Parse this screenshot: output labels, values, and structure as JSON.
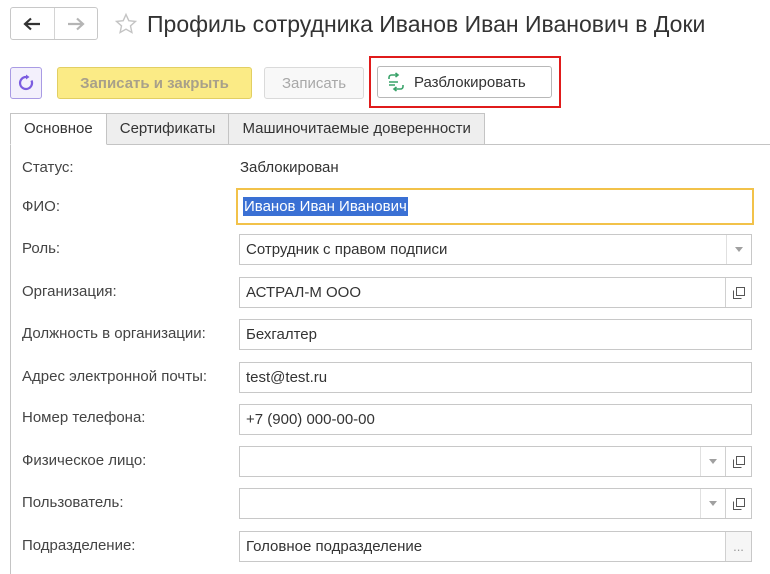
{
  "window": {
    "title": "Профиль сотрудника Иванов Иван Иванович в Доки"
  },
  "toolbar": {
    "save_close_label": "Записать и закрыть",
    "save_label": "Записать",
    "unlock_label": "Разблокировать"
  },
  "tabs": [
    {
      "label": "Основное",
      "active": true
    },
    {
      "label": "Сертификаты",
      "active": false
    },
    {
      "label": "Машиночитаемые доверенности",
      "active": false
    }
  ],
  "form": {
    "status": {
      "label": "Статус:",
      "value": "Заблокирован"
    },
    "fio": {
      "label": "ФИО:",
      "value": "Иванов Иван Иванович"
    },
    "role": {
      "label": "Роль:",
      "value": "Сотрудник с правом подписи"
    },
    "organization": {
      "label": "Организация:",
      "value": "АСТРАЛ-М ООО"
    },
    "position": {
      "label": "Должность в организации:",
      "value": "Бехгалтер"
    },
    "email": {
      "label": "Адрес электронной почты:",
      "value": "test@test.ru"
    },
    "phone": {
      "label": "Номер телефона:",
      "value": "+7 (900) 000-00-00"
    },
    "person": {
      "label": "Физическое лицо:",
      "value": ""
    },
    "user": {
      "label": "Пользователь:",
      "value": ""
    },
    "department": {
      "label": "Подразделение:",
      "value": "Головное подразделение"
    }
  },
  "colors": {
    "accent_yellow": "#fbeb86",
    "focus_border": "#f2c24a",
    "highlight_red": "#e01b1b",
    "selection_blue": "#3a70d4",
    "refresh_purple": "#7b5ce0",
    "unlock_green": "#3aa36a"
  },
  "icons": {
    "back": "arrow-left-icon",
    "forward": "arrow-right-icon",
    "favorite": "star-icon",
    "refresh": "refresh-icon",
    "unlock": "unlock-icon",
    "dropdown": "chevron-down-icon",
    "open": "open-window-icon",
    "choose": "ellipsis-icon"
  }
}
